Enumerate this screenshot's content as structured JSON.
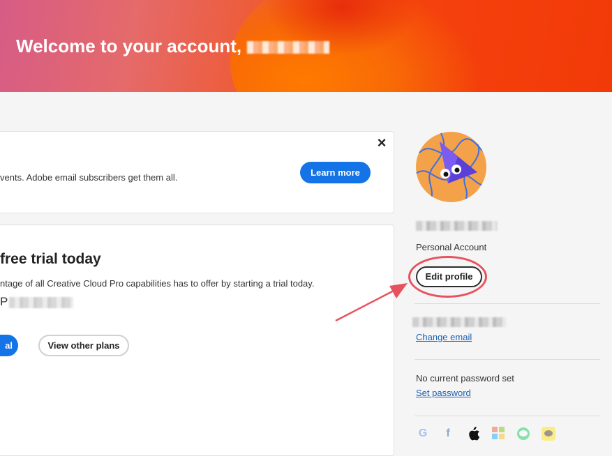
{
  "hero": {
    "welcome_text": "Welcome to your account,"
  },
  "promo_card": {
    "text": "vents. Adobe email subscribers get them all.",
    "learn_more": "Learn more",
    "close_label": "×"
  },
  "trial_card": {
    "title": "free trial today",
    "description": "ntage of all Creative Cloud Pro capabilities has to offer by starting a trial today.",
    "price_prefix": "P",
    "start_trial": "al",
    "view_plans": "View other plans"
  },
  "profile": {
    "account_type": "Personal Account",
    "edit_profile": "Edit profile",
    "change_email": "Change email",
    "password_status": "No current password set",
    "set_password": "Set password"
  },
  "social_icons": [
    "google-icon",
    "facebook-icon",
    "apple-icon",
    "microsoft-icon",
    "line-icon",
    "kakao-icon"
  ],
  "colors": {
    "accent_blue": "#1473e6",
    "annotation_red": "#e8525e",
    "hero_orange": "#f5430f"
  }
}
